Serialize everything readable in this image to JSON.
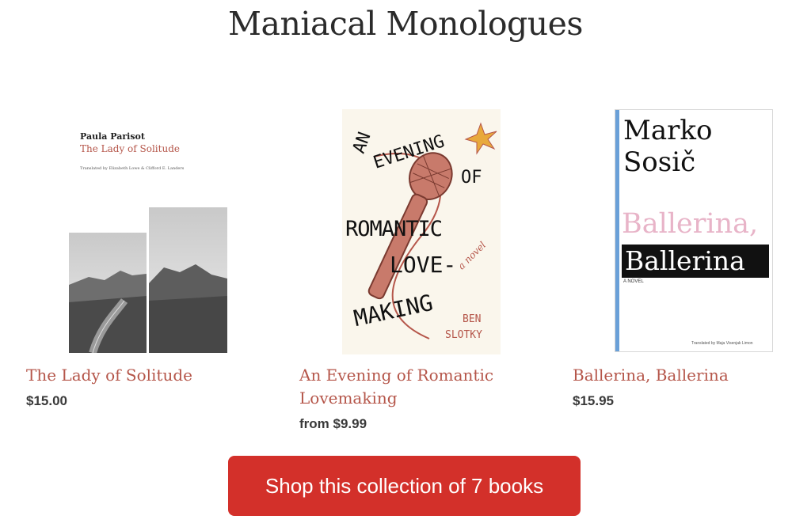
{
  "collection": {
    "title": "Maniacal Monologues"
  },
  "books": [
    {
      "title": "The Lady of Solitude",
      "price": "$15.00",
      "cover": {
        "author": "Paula Parisot",
        "title": "The Lady of Solitude",
        "credit": "Translated by Elizabeth Lowe & Clifford E. Landers"
      }
    },
    {
      "title": "An Evening of Romantic Lovemaking",
      "title_line1": "An Evening of Romantic",
      "title_line2": "Lovemaking",
      "price": "from $9.99",
      "cover": {
        "line1": "AN",
        "line2": "EVENING",
        "line3": "OF",
        "line4": "ROMANTIC",
        "line5": "LOVE-",
        "line6": "MAKING",
        "tagline": "a novel",
        "author1": "BEN",
        "author2": "SLOTKY"
      }
    },
    {
      "title": "Ballerina, Ballerina",
      "price": "$15.95",
      "cover": {
        "author1": "Marko",
        "author2": "Sosič",
        "title1": "Ballerina,",
        "title2": "Ballerina",
        "tag": "A NOVEL",
        "credit": "Translated by Maja Visenjak Limon"
      }
    }
  ],
  "cta": {
    "label": "Shop this collection of 7 books"
  },
  "colors": {
    "accent": "#d3302a",
    "title_link": "#b5564a",
    "pink_title": "#e8b4c8"
  }
}
